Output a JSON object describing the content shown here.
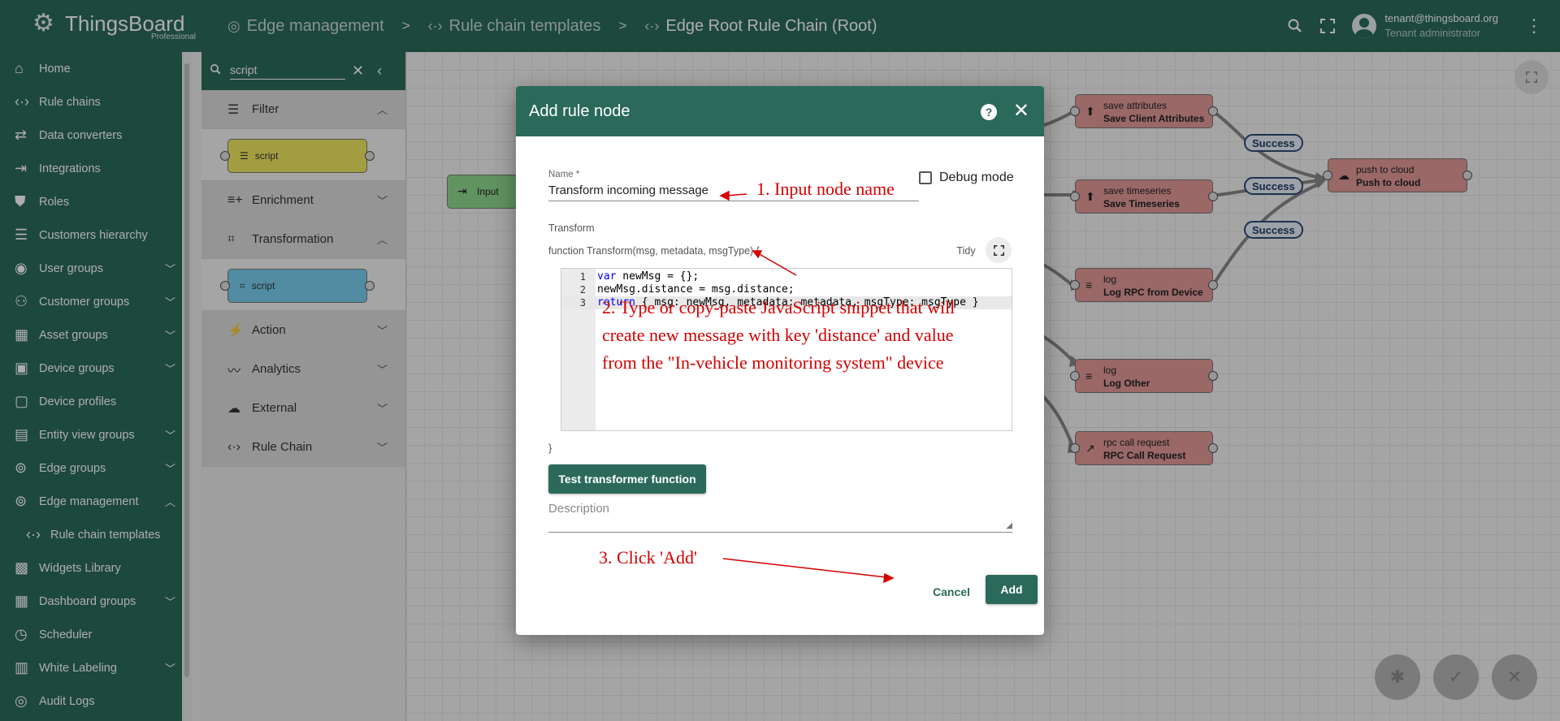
{
  "topbar": {
    "logo_text": "ThingsBoard",
    "logo_sub": "Professional",
    "breadcrumbs": [
      {
        "label": "Edge management",
        "icon": "router-icon"
      },
      {
        "label": "Rule chain templates",
        "icon": "code-brackets-icon"
      },
      {
        "label": "Edge Root Rule Chain (Root)",
        "icon": "code-brackets-icon"
      }
    ],
    "separator": ">",
    "user_email": "tenant@thingsboard.org",
    "user_role": "Tenant administrator"
  },
  "sidebar": {
    "items": [
      {
        "label": "Home",
        "icon": "home-icon"
      },
      {
        "label": "Rule chains",
        "icon": "code-brackets-icon"
      },
      {
        "label": "Data converters",
        "icon": "transform-icon"
      },
      {
        "label": "Integrations",
        "icon": "input-icon"
      },
      {
        "label": "Roles",
        "icon": "shield-icon"
      },
      {
        "label": "Customers hierarchy",
        "icon": "sort-icon"
      },
      {
        "label": "User groups",
        "icon": "account-circle-icon",
        "expand": true
      },
      {
        "label": "Customer groups",
        "icon": "supervisor-icon",
        "expand": true
      },
      {
        "label": "Asset groups",
        "icon": "domain-icon",
        "expand": true
      },
      {
        "label": "Device groups",
        "icon": "devices-icon",
        "expand": true
      },
      {
        "label": "Device profiles",
        "icon": "device-profile-icon"
      },
      {
        "label": "Entity view groups",
        "icon": "view-quilt-icon",
        "expand": true
      },
      {
        "label": "Edge groups",
        "icon": "router-icon",
        "expand": true
      },
      {
        "label": "Edge management",
        "icon": "router-icon",
        "expand": true,
        "open": true
      },
      {
        "label": "Rule chain templates",
        "icon": "code-brackets-icon",
        "sub": true
      },
      {
        "label": "Widgets Library",
        "icon": "widgets-icon"
      },
      {
        "label": "Dashboard groups",
        "icon": "dashboards-icon",
        "expand": true
      },
      {
        "label": "Scheduler",
        "icon": "schedule-icon"
      },
      {
        "label": "White Labeling",
        "icon": "format-paint-icon",
        "expand": true
      },
      {
        "label": "Audit Logs",
        "icon": "track-changes-icon"
      }
    ]
  },
  "library": {
    "search_value": "script",
    "sections": {
      "filter": "Filter",
      "enrichment": "Enrichment",
      "transformation": "Transformation",
      "action": "Action",
      "analytics": "Analytics",
      "external": "External",
      "rule_chain": "Rule Chain"
    },
    "filter_node": "script",
    "transform_node": "script",
    "colors": {
      "filter": "#f1e861",
      "transformation": "#79cef1"
    }
  },
  "canvas": {
    "input_node": "Input",
    "nodes": [
      {
        "type": "save attributes",
        "name": "Save Client Attributes",
        "icon": "upload-icon"
      },
      {
        "type": "save timeseries",
        "name": "Save Timeseries",
        "icon": "upload-icon"
      },
      {
        "type": "log",
        "name": "Log RPC from Device",
        "icon": "menu-icon"
      },
      {
        "type": "log",
        "name": "Log Other",
        "icon": "menu-icon"
      },
      {
        "type": "rpc call request",
        "name": "RPC Call Request",
        "icon": "call-made-icon"
      },
      {
        "type": "push to cloud",
        "name": "Push to cloud",
        "icon": "cloud-upload-icon"
      }
    ],
    "link_labels": [
      "Success",
      "Success",
      "Success"
    ],
    "node_color": "#e29a98"
  },
  "dialog": {
    "title": "Add rule node",
    "name_label": "Name *",
    "name_value": "Transform incoming message",
    "debug_label": "Debug mode",
    "transform_label": "Transform",
    "fn_header": "function Transform(msg, metadata, msgType) {",
    "tidy_label": "Tidy",
    "code": [
      {
        "n": "1",
        "kw": "var",
        "rest": " newMsg = {};"
      },
      {
        "n": "2",
        "kw": "",
        "rest": "newMsg.distance = msg.distance;"
      },
      {
        "n": "3",
        "kw": "return",
        "rest": " { msg: newMsg, metadata: metadata, msgType: msgType }"
      }
    ],
    "fn_close": "}",
    "test_button": "Test transformer function",
    "description_placeholder": "Description",
    "cancel_label": "Cancel",
    "add_label": "Add"
  },
  "annotations": {
    "step1": "1. Input node name",
    "step2_line1": "2. Type or copy-paste JavaScript snippet that will",
    "step2_line2": "create new message with key 'distance' and value",
    "step2_line3": "from the \"In-vehicle monitoring system\" device",
    "step3": "3. Click 'Add'"
  }
}
